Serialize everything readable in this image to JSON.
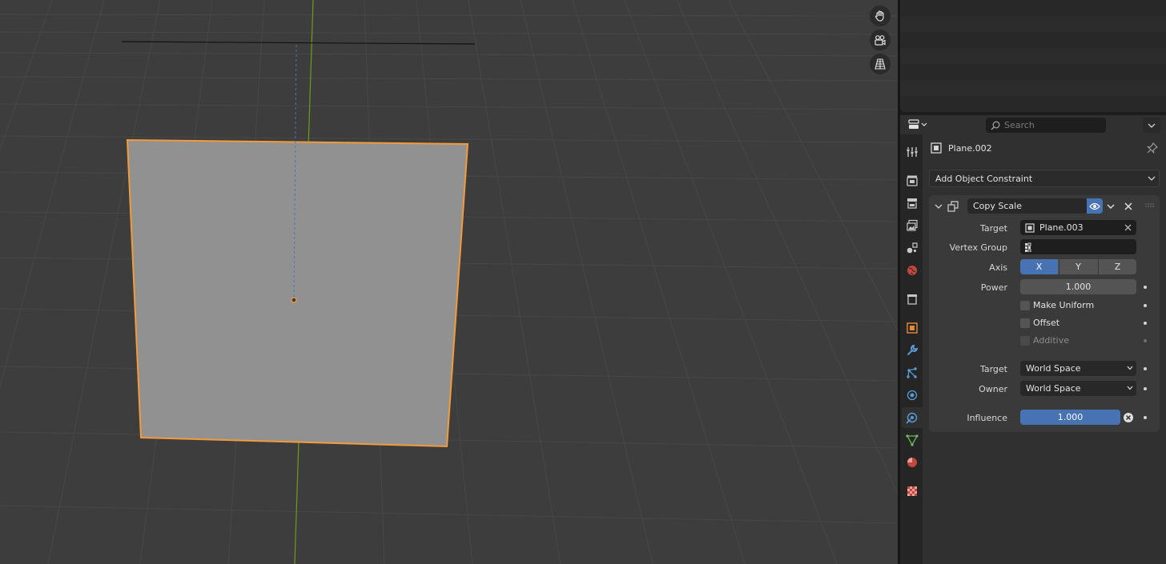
{
  "properties_header": {
    "search_placeholder": "Search"
  },
  "tabs": [
    {
      "name": "tool",
      "icon": "tool-icon"
    },
    {
      "name": "render",
      "icon": "render-icon"
    },
    {
      "name": "output",
      "icon": "output-icon"
    },
    {
      "name": "view-layer",
      "icon": "view-layer-icon"
    },
    {
      "name": "scene",
      "icon": "scene-icon"
    },
    {
      "name": "world",
      "icon": "world-icon"
    },
    {
      "name": "collection",
      "icon": "collection-icon"
    },
    {
      "name": "object",
      "icon": "object-icon"
    },
    {
      "name": "modifiers",
      "icon": "wrench-icon"
    },
    {
      "name": "particles",
      "icon": "particles-icon"
    },
    {
      "name": "physics",
      "icon": "physics-icon"
    },
    {
      "name": "constraints",
      "icon": "constraint-icon",
      "active": true
    },
    {
      "name": "data",
      "icon": "mesh-data-icon"
    },
    {
      "name": "material",
      "icon": "material-icon"
    },
    {
      "name": "texture",
      "icon": "texture-icon"
    }
  ],
  "context": {
    "object_name": "Plane.002"
  },
  "add_constraint_label": "Add Object Constraint",
  "constraint": {
    "name": "Copy Scale",
    "target_label": "Target",
    "target_value": "Plane.003",
    "vertex_group_label": "Vertex Group",
    "vertex_group_value": "",
    "axis_label": "Axis",
    "axes": [
      "X",
      "Y",
      "Z"
    ],
    "axes_enabled": [
      true,
      false,
      false
    ],
    "power_label": "Power",
    "power_value": "1.000",
    "make_uniform_label": "Make Uniform",
    "make_uniform": false,
    "offset_label": "Offset",
    "offset": false,
    "additive_label": "Additive",
    "additive": false,
    "target_space_label": "Target",
    "target_space_value": "World Space",
    "owner_space_label": "Owner",
    "owner_space_value": "World Space",
    "influence_label": "Influence",
    "influence_value": "1.000",
    "influence": 1.0
  },
  "colors": {
    "accent": "#4772b3",
    "selection": "#f39a3a",
    "viewport_bg": "#3d3d3d",
    "plane_fill": "#919191",
    "y_axis": "#6f9a1e"
  }
}
